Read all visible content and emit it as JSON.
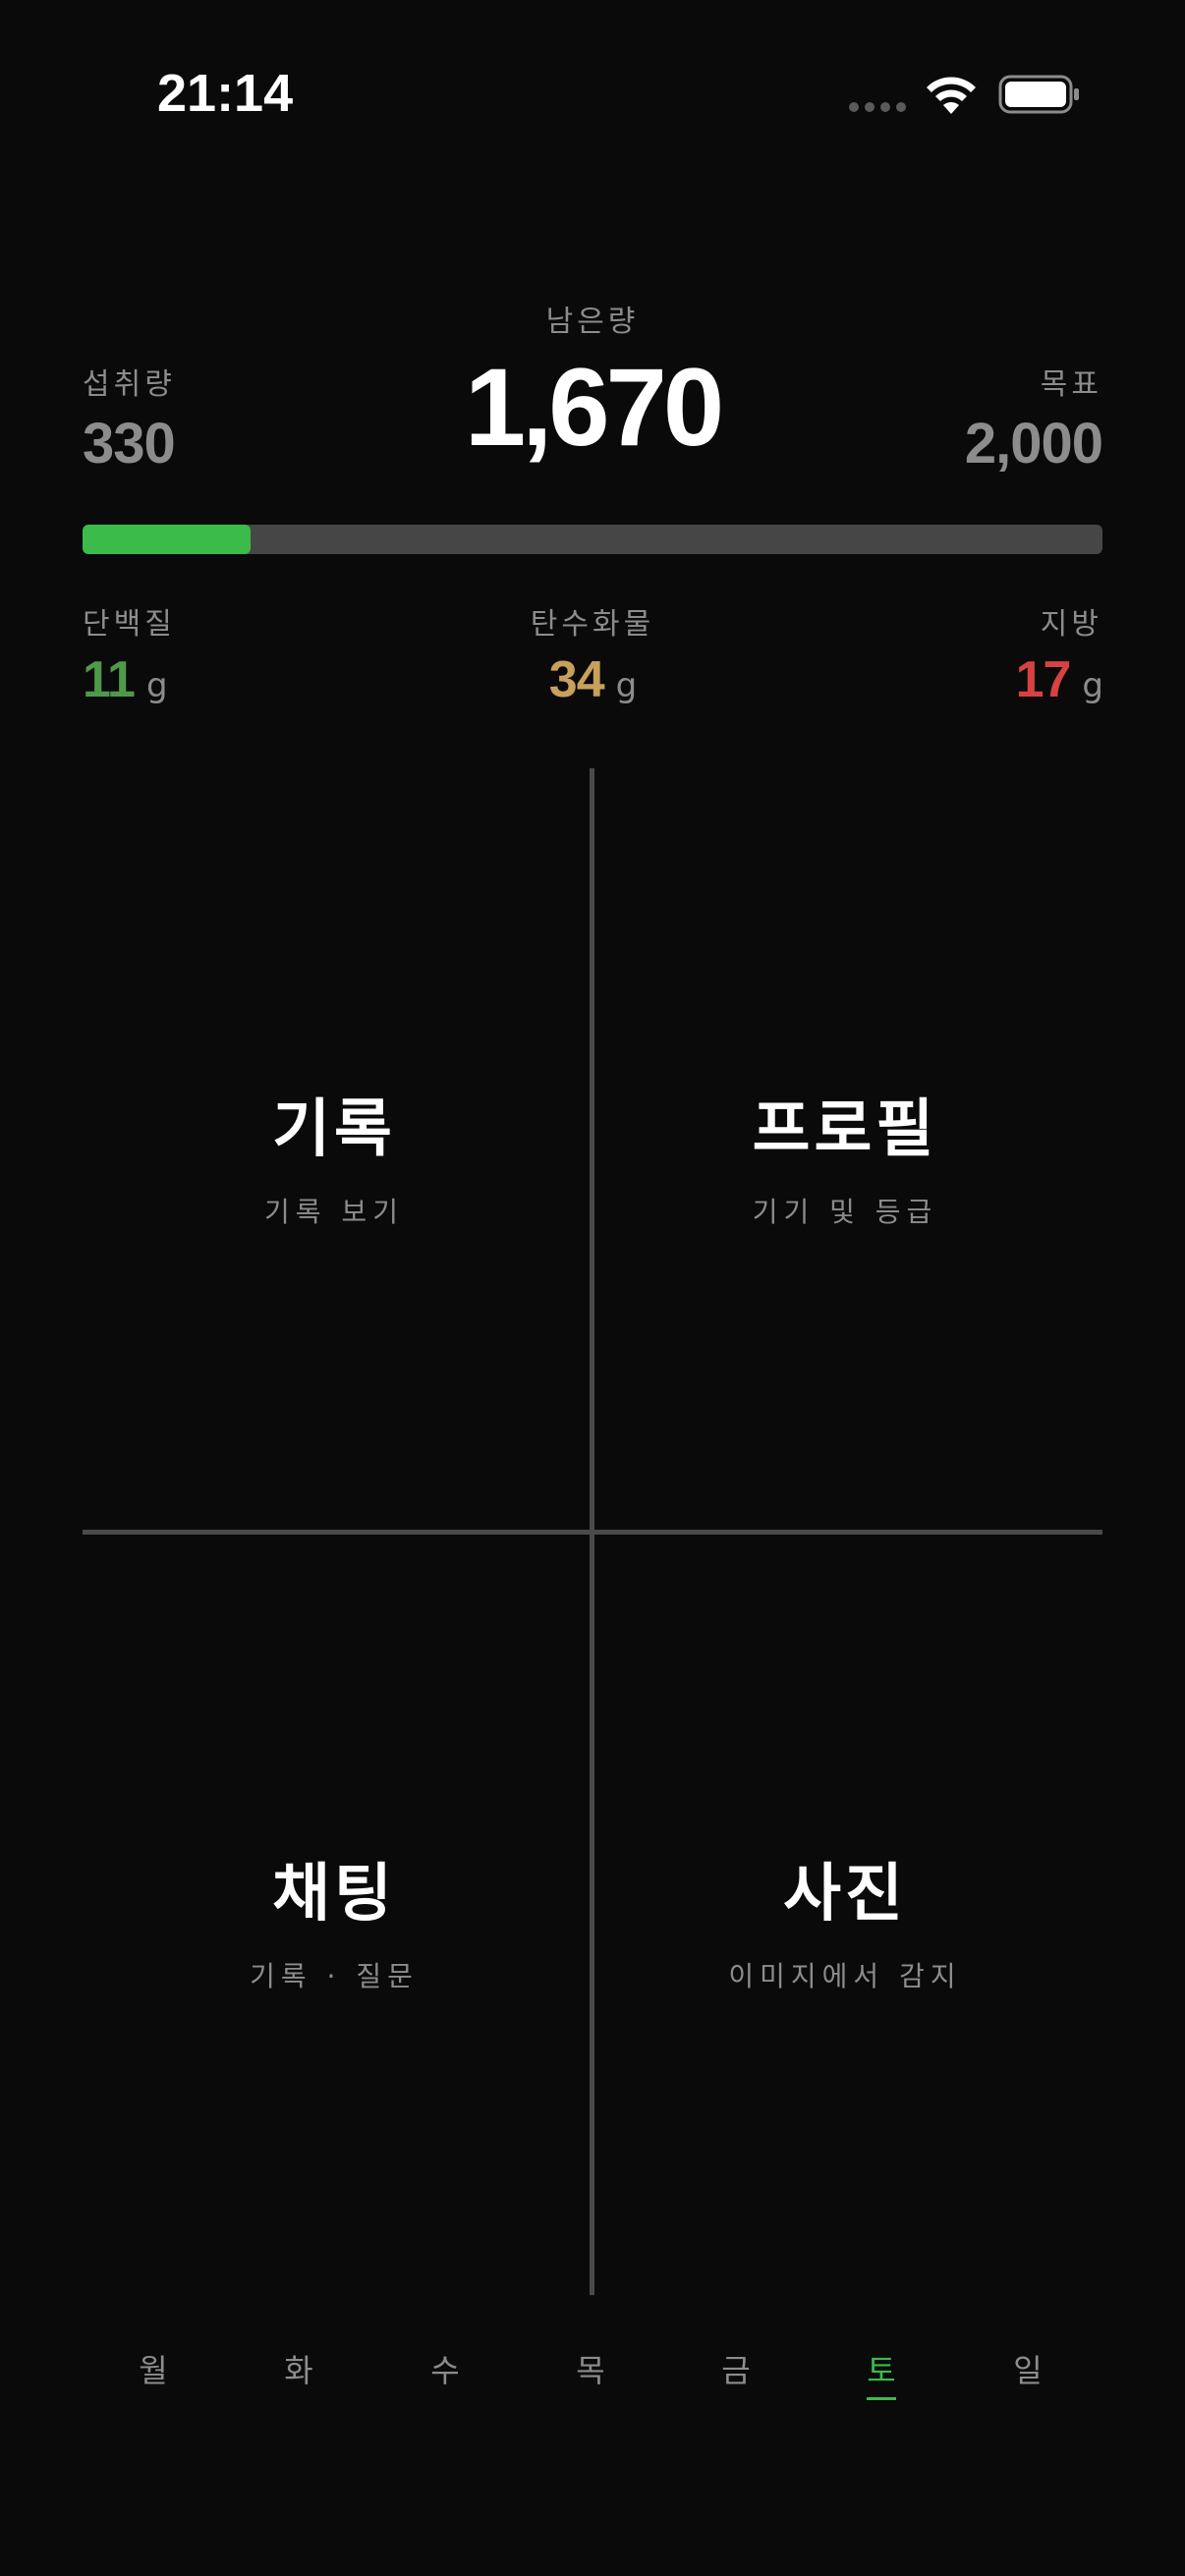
{
  "status_bar": {
    "time": "21:14",
    "icons": [
      "cellular-signal-icon",
      "wifi-icon",
      "battery-icon"
    ]
  },
  "summary": {
    "remaining_label": "남은량",
    "remaining_value": "1,670",
    "intake_label": "섭취량",
    "intake_value": "330",
    "goal_label": "목표",
    "goal_value": "2,000",
    "progress_fraction": 0.165
  },
  "macros": {
    "protein": {
      "label": "단백질",
      "value": "11",
      "unit": "g"
    },
    "carbs": {
      "label": "탄수화물",
      "value": "34",
      "unit": "g"
    },
    "fat": {
      "label": "지방",
      "value": "17",
      "unit": "g"
    }
  },
  "tiles": {
    "records": {
      "title": "기록",
      "subtitle": "기록 보기"
    },
    "profile": {
      "title": "프로필",
      "subtitle": "기기 및 등급"
    },
    "chat": {
      "title": "채팅",
      "subtitle": "기록 · 질문"
    },
    "photo": {
      "title": "사진",
      "subtitle": "이미지에서 감지"
    }
  },
  "week": {
    "days": [
      "월",
      "화",
      "수",
      "목",
      "금",
      "토",
      "일"
    ],
    "active_index": 5
  },
  "colors": {
    "background": "#0a0a0a",
    "accent_green": "#3bbb4a",
    "protein": "#4f9a4a",
    "carbs": "#c8a05c",
    "fat": "#d64242",
    "muted": "#8c8c8c"
  }
}
